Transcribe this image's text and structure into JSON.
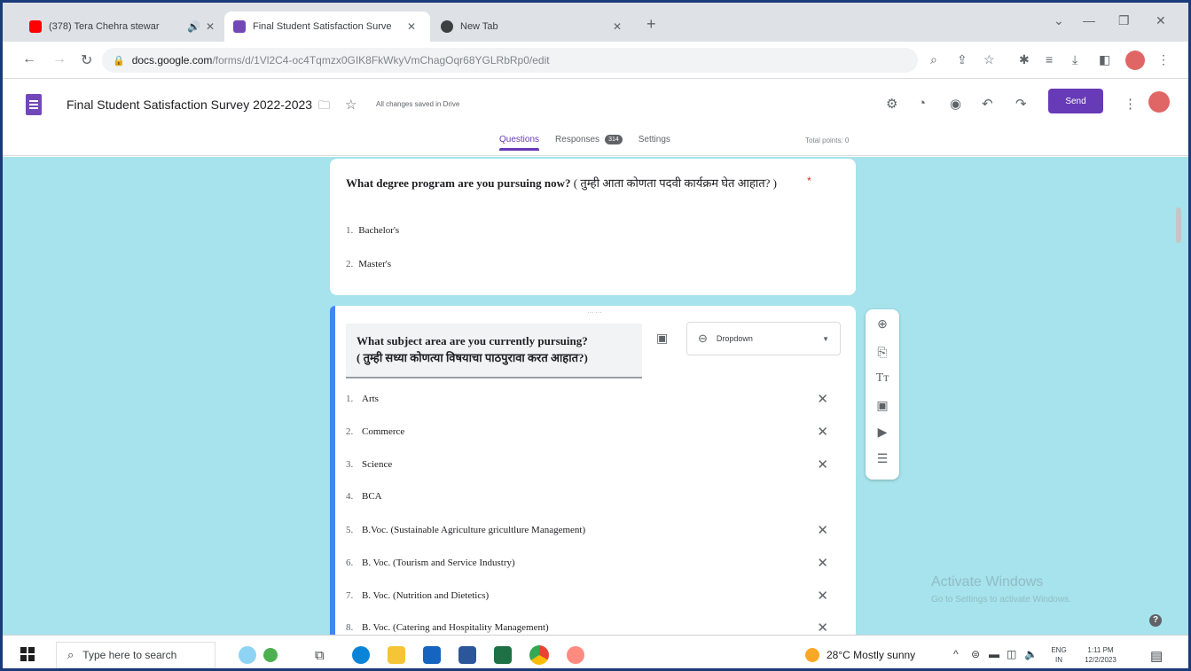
{
  "browser": {
    "tabs": [
      {
        "title": "(378) Tera Chehra stewar",
        "favicon_color": "#ff0000"
      },
      {
        "title": "Final Student Satisfaction Surve",
        "favicon_color": "#7248b9"
      },
      {
        "title": "New Tab",
        "favicon_color": "#3c4043"
      }
    ],
    "url_host": "docs.google.com",
    "url_path": "/forms/d/1Vl2C4-oc4Tqmzx0GIK8FkWkyVmChagOqr68YGLRbRp0/edit"
  },
  "form": {
    "title": "Final Student Satisfaction Survey 2022-2023",
    "save_status": "All changes saved in Drive",
    "send_label": "Send",
    "tabs": {
      "questions": "Questions",
      "responses": "Responses",
      "responses_count": "314",
      "settings": "Settings"
    },
    "total_points": "Total points: 0"
  },
  "question1": {
    "title": "What degree program are you pursuing now?",
    "title_sub": "( तुम्ही आता कोणता पदवी कार्यक्रम घेत आहात? )",
    "required_mark": "*",
    "options": [
      {
        "num": "1.",
        "label": "Bachelor's"
      },
      {
        "num": "2.",
        "label": "Master's"
      }
    ]
  },
  "question2": {
    "title": "What subject area are you currently pursuing?",
    "title_sub": "( तुम्ही सध्या कोणत्या विषयाचा पाठपुरावा करत आहात?)",
    "type_label": "Dropdown",
    "options": [
      {
        "num": "1.",
        "label": "Arts"
      },
      {
        "num": "2.",
        "label": "Commerce"
      },
      {
        "num": "3.",
        "label": "Science"
      },
      {
        "num": "4.",
        "label": "BCA"
      },
      {
        "num": "5.",
        "label": "B.Voc. (Sustainable Agriculture gricultlure Management)"
      },
      {
        "num": "6.",
        "label": "B. Voc. (Tourism and Service Industry)"
      },
      {
        "num": "7.",
        "label": "B. Voc. (Nutrition and Dietetics)"
      },
      {
        "num": "8.",
        "label": "B. Voc. (Catering and Hospitality Management)"
      }
    ]
  },
  "windows": {
    "watermark_title": "Activate Windows",
    "watermark_sub": "Go to Settings to activate Windows.",
    "search_placeholder": "Type here to search",
    "weather": "28°C  Mostly sunny",
    "lang": "ENG",
    "region": "IN",
    "time": "1:11 PM",
    "date": "12/2/2023"
  },
  "colors": {
    "accent": "#673ab7",
    "canvas": "#a6e3ec",
    "active_question": "#4285f4"
  }
}
